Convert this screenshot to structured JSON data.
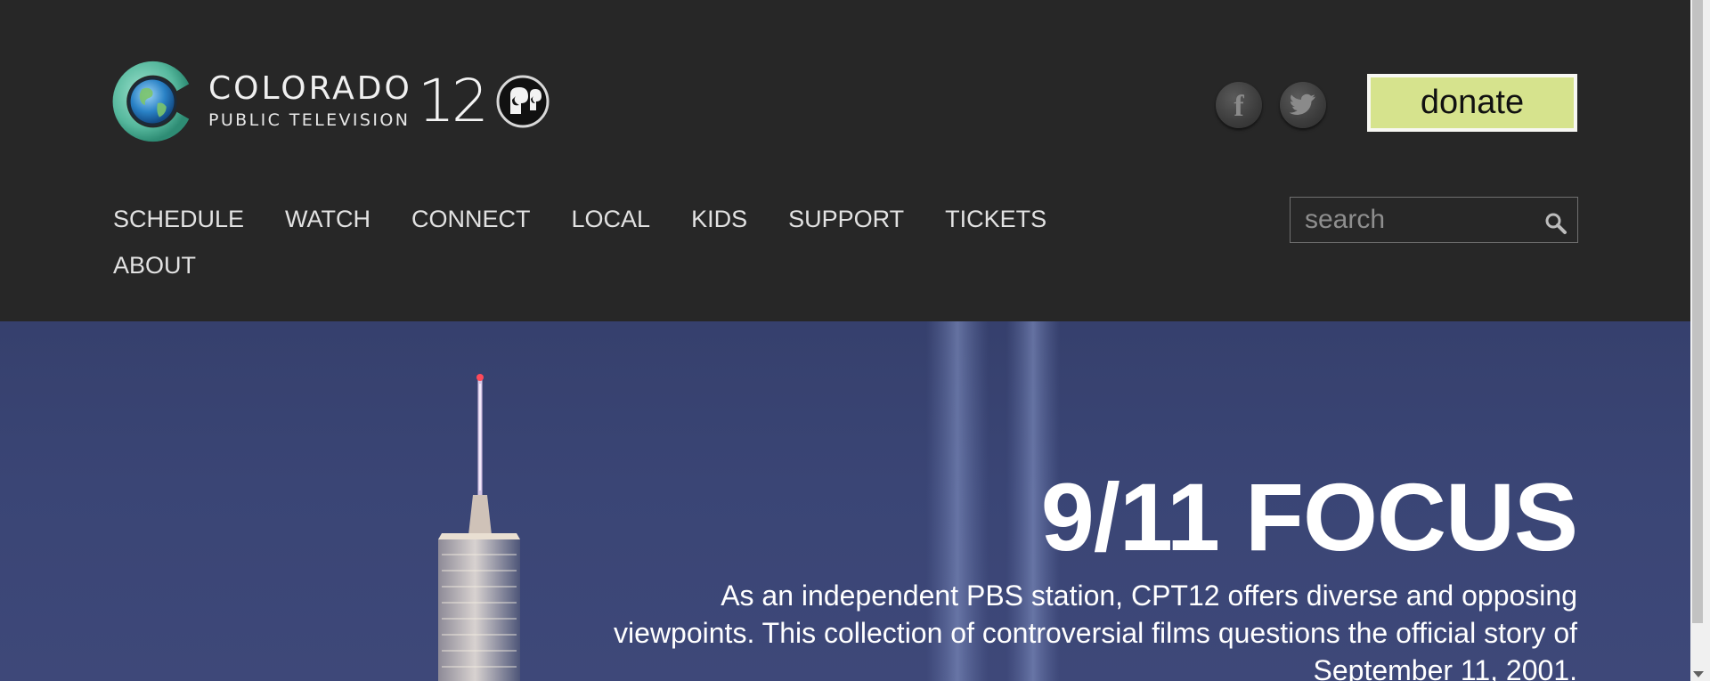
{
  "brand": {
    "name": "COLORADO",
    "subtitle": "PUBLIC TELEVISION",
    "channel": "12"
  },
  "header": {
    "donate_label": "donate",
    "social": [
      {
        "name": "facebook",
        "icon": "facebook-icon",
        "glyph": "f"
      },
      {
        "name": "twitter",
        "icon": "twitter-icon"
      }
    ]
  },
  "nav": {
    "items": [
      "SCHEDULE",
      "WATCH",
      "CONNECT",
      "LOCAL",
      "KIDS",
      "SUPPORT",
      "TICKETS",
      "ABOUT"
    ]
  },
  "search": {
    "placeholder": "search",
    "value": "",
    "icon": "magnifier-icon"
  },
  "hero": {
    "title": "9/11 FOCUS",
    "description": "As an independent PBS station, CPT12 offers diverse and opposing viewpoints. This collection of controversial films questions the official story of September 11, 2001."
  },
  "colors": {
    "header_bg": "#272727",
    "donate_bg": "#d6e38d",
    "hero_bg": "#3a4575",
    "nav_text": "#e2e2e2"
  }
}
